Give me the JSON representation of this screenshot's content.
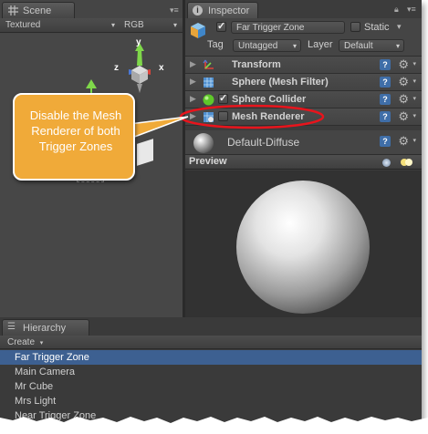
{
  "scene": {
    "tab_label": "Scene",
    "render_mode": "Textured",
    "color_mode": "RGB",
    "gizmo_axes": {
      "y": "y",
      "x": "x",
      "z": "z"
    }
  },
  "inspector": {
    "tab_label": "Inspector",
    "object_name": "Far Trigger Zone",
    "active_checked": true,
    "static_label": "Static",
    "static_checked": false,
    "tag_label": "Tag",
    "tag_value": "Untagged",
    "layer_label": "Layer",
    "layer_value": "Default",
    "components": [
      {
        "name": "Transform",
        "icon": "transform-icon",
        "has_checkbox": false
      },
      {
        "name": "Sphere (Mesh Filter)",
        "icon": "mesh-filter-icon",
        "has_checkbox": false
      },
      {
        "name": "Sphere Collider",
        "icon": "sphere-collider-icon",
        "has_checkbox": true,
        "checked": true
      },
      {
        "name": "Mesh Renderer",
        "icon": "mesh-renderer-icon",
        "has_checkbox": true,
        "checked": false
      }
    ],
    "material_name": "Default-Diffuse",
    "preview_label": "Preview"
  },
  "hierarchy": {
    "tab_label": "Hierarchy",
    "create_label": "Create",
    "items": [
      "Far Trigger Zone",
      "Main Camera",
      "Mr Cube",
      "Mrs Light",
      "Near Trigger Zone"
    ],
    "selected_index": 0
  },
  "callout": {
    "text": "Disable the Mesh Renderer of both Trigger Zones",
    "fill_color": "#f0aa39",
    "highlight_color": "#e8141c"
  },
  "colors": {
    "selection": "#3d6091",
    "panel": "#3c3c3c",
    "help_icon": "#3f6ea8"
  }
}
